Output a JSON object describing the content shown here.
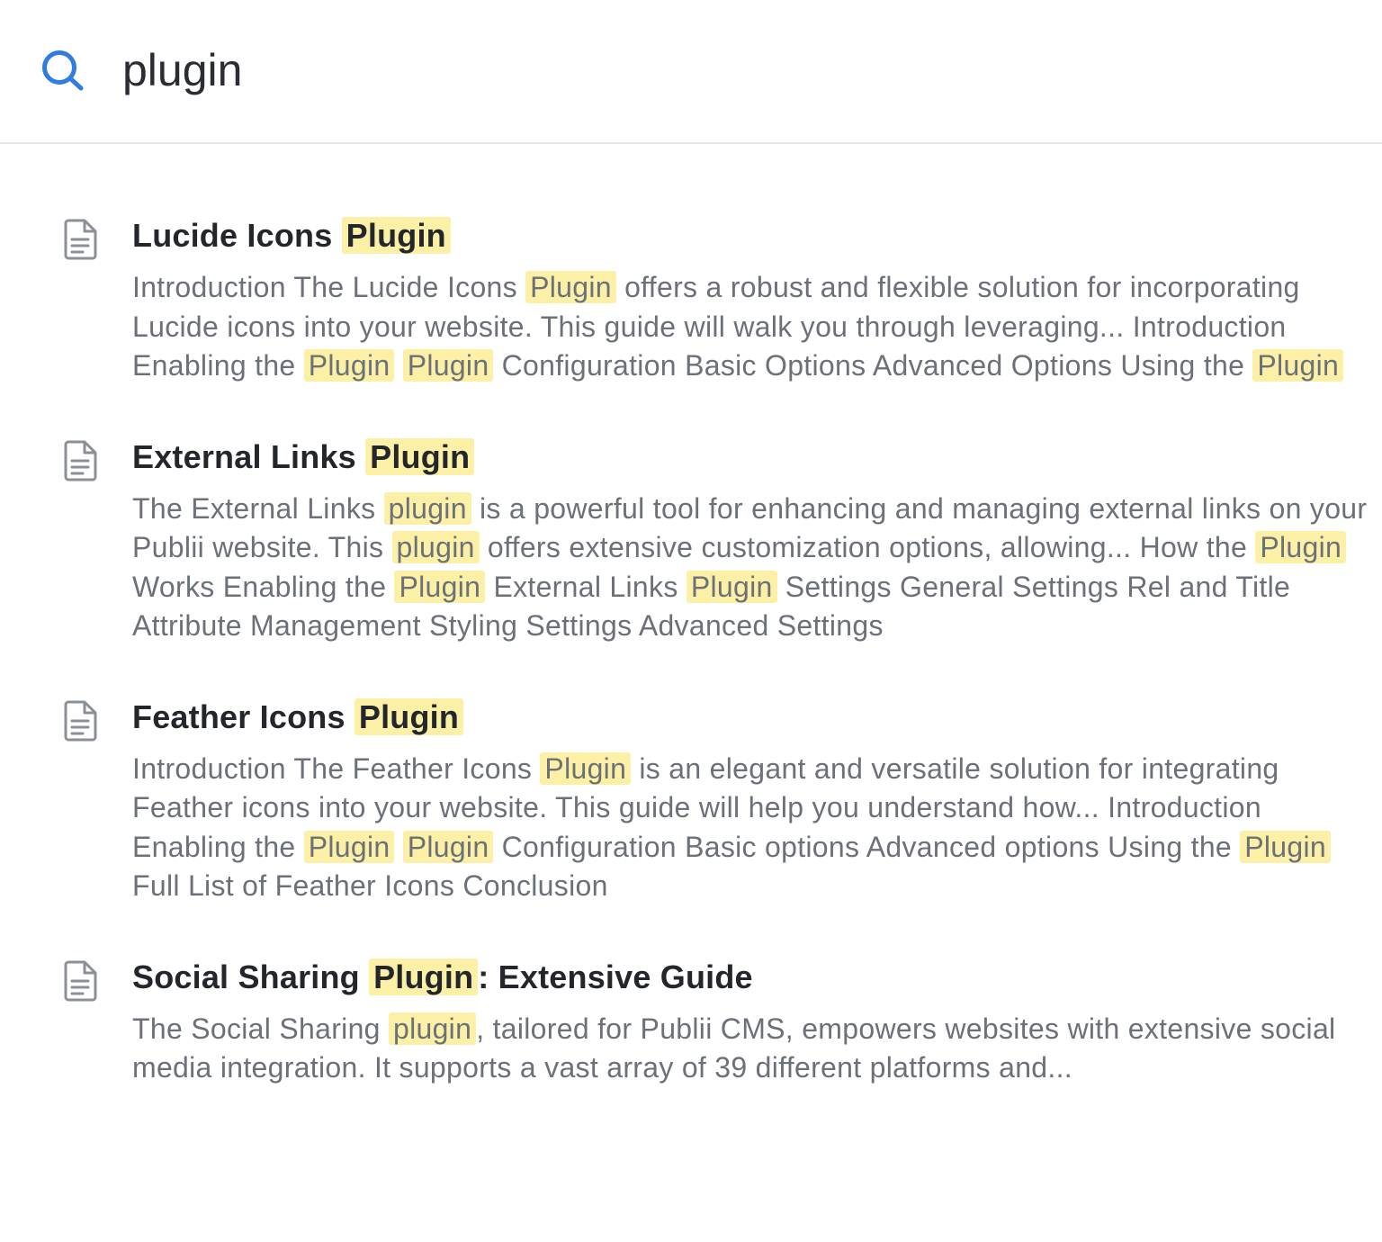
{
  "search": {
    "query": "plugin"
  },
  "results": [
    {
      "title": [
        {
          "text": "Lucide Icons "
        },
        {
          "text": "Plugin",
          "hl": true
        }
      ],
      "snippet": [
        {
          "text": "Introduction The Lucide Icons "
        },
        {
          "text": "Plugin",
          "hl": true
        },
        {
          "text": " offers a robust and flexible solution for incorporating Lucide icons into your website. This guide will walk you through leveraging... Introduction Enabling the "
        },
        {
          "text": "Plugin",
          "hl": true
        },
        {
          "text": " "
        },
        {
          "text": "Plugin",
          "hl": true
        },
        {
          "text": " Configuration Basic Options Advanced Options Using the "
        },
        {
          "text": "Plugin",
          "hl": true
        }
      ]
    },
    {
      "title": [
        {
          "text": "External Links "
        },
        {
          "text": "Plugin",
          "hl": true
        }
      ],
      "snippet": [
        {
          "text": "The External Links "
        },
        {
          "text": "plugin",
          "hl": true
        },
        {
          "text": " is a powerful tool for enhancing and managing external links on your Publii website. This "
        },
        {
          "text": "plugin",
          "hl": true
        },
        {
          "text": " offers extensive customization options, allowing... How the "
        },
        {
          "text": "Plugin",
          "hl": true
        },
        {
          "text": " Works Enabling the "
        },
        {
          "text": "Plugin",
          "hl": true
        },
        {
          "text": " External Links "
        },
        {
          "text": "Plugin",
          "hl": true
        },
        {
          "text": " Settings General Settings Rel and Title Attribute Management Styling Settings Advanced Settings"
        }
      ]
    },
    {
      "title": [
        {
          "text": "Feather Icons "
        },
        {
          "text": "Plugin",
          "hl": true
        }
      ],
      "snippet": [
        {
          "text": "Introduction The Feather Icons "
        },
        {
          "text": "Plugin",
          "hl": true
        },
        {
          "text": " is an elegant and versatile solution for integrating Feather icons into your website. This guide will help you understand how... Introduction Enabling the "
        },
        {
          "text": "Plugin",
          "hl": true
        },
        {
          "text": " "
        },
        {
          "text": "Plugin",
          "hl": true
        },
        {
          "text": " Configuration Basic options Advanced options Using the "
        },
        {
          "text": "Plugin",
          "hl": true
        },
        {
          "text": " Full List of Feather Icons Conclusion"
        }
      ]
    },
    {
      "title": [
        {
          "text": "Social Sharing "
        },
        {
          "text": "Plugin",
          "hl": true
        },
        {
          "text": ": Extensive Guide"
        }
      ],
      "snippet": [
        {
          "text": "The Social Sharing "
        },
        {
          "text": "plugin",
          "hl": true
        },
        {
          "text": ", tailored for Publii CMS, empowers websites with extensive social media integration. It supports a vast array of 39 different platforms and..."
        }
      ]
    }
  ],
  "colors": {
    "accent": "#2f7de1",
    "highlight": "#fcf0a6",
    "title": "#23262b",
    "snippet": "#6b7079"
  }
}
